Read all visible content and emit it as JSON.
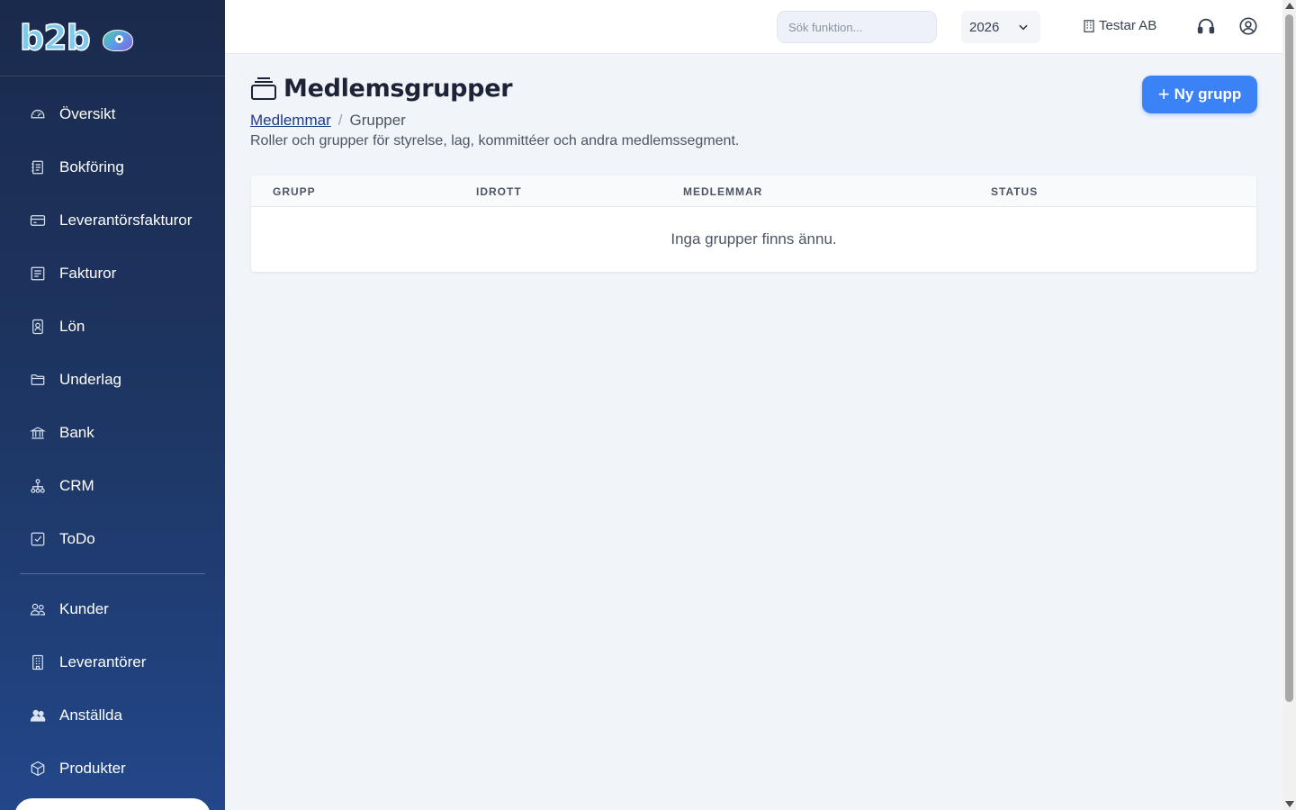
{
  "brand": {
    "logo_text": "b2b"
  },
  "sidebar": {
    "items": [
      {
        "label": "Översikt",
        "icon": "gauge-icon"
      },
      {
        "label": "Bokföring",
        "icon": "ledger-icon"
      },
      {
        "label": "Leverantörsfakturor",
        "icon": "credit-card-icon"
      },
      {
        "label": "Fakturor",
        "icon": "invoice-icon"
      },
      {
        "label": "Lön",
        "icon": "badge-icon"
      },
      {
        "label": "Underlag",
        "icon": "folder-icon"
      },
      {
        "label": "Bank",
        "icon": "bank-icon"
      },
      {
        "label": "CRM",
        "icon": "network-icon"
      },
      {
        "label": "ToDo",
        "icon": "checkbox-icon"
      }
    ],
    "items_secondary": [
      {
        "label": "Kunder",
        "icon": "users-icon"
      },
      {
        "label": "Leverantörer",
        "icon": "building-icon"
      },
      {
        "label": "Anställda",
        "icon": "people-icon"
      },
      {
        "label": "Produkter",
        "icon": "box-icon"
      }
    ]
  },
  "topbar": {
    "search_placeholder": "Sök funktion...",
    "year": "2026",
    "company": "Testar AB"
  },
  "page": {
    "title": "Medlemsgrupper",
    "title_icon": "stack-icon",
    "breadcrumb_parent": "Medlemmar",
    "breadcrumb_separator": "/",
    "breadcrumb_current": "Grupper",
    "subtitle": "Roller och grupper för styrelse, lag, kommittéer och andra medlemssegment.",
    "new_button_plus": "+",
    "new_button_label": "Ny grupp"
  },
  "table": {
    "columns": [
      "GRUPP",
      "IDROTT",
      "MEDLEMMAR",
      "STATUS"
    ],
    "empty_message": "Inga grupper finns ännu."
  },
  "colors": {
    "sidebar_top": "#1a2a4c",
    "sidebar_bottom": "#22478a",
    "accent": "#3b82f6",
    "background": "#f1f4f9"
  }
}
